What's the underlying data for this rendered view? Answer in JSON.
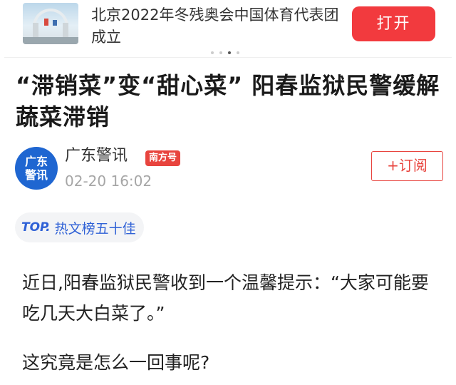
{
  "banner": {
    "title": "北京2022年冬残奥会中国体育代表团成立",
    "open_label": "打开"
  },
  "article": {
    "headline": "“滞销菜”变“甜心菜” 阳春监狱民警缓解蔬菜滞销",
    "author": {
      "avatar_line1": "广东",
      "avatar_line2": "警讯",
      "name": "广东警讯",
      "source_badge": "南方号",
      "time": "02-20 16:02",
      "subscribe_label": "+订阅"
    },
    "top_tag": {
      "logo": "TOP.",
      "text": "热文榜五十佳"
    },
    "paragraphs": [
      "近日,阳春监狱民警收到一个温馨提示：“大家可能要吃几天大白菜了。”",
      "这究竟是怎么一回事呢?"
    ]
  },
  "colors": {
    "accent_red": "#f23a3e",
    "badge_red": "#e8443e",
    "link_blue": "#2f61d6",
    "avatar_blue": "#1f66d1"
  },
  "icons": {
    "banner_thumbnail": "olympic-venue-thumbnail",
    "avatar": "guangdong-jingxun-avatar"
  }
}
